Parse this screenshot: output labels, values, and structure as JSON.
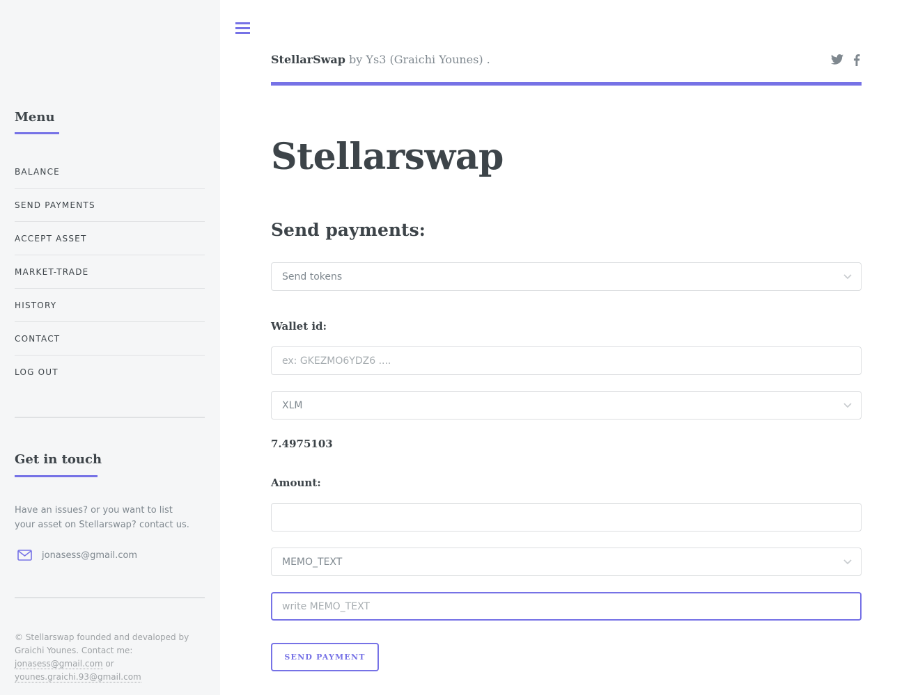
{
  "sidebar": {
    "menu_heading": "Menu",
    "items": [
      {
        "label": "BALANCE"
      },
      {
        "label": "SEND PAYMENTS"
      },
      {
        "label": "ACCEPT ASSET"
      },
      {
        "label": "MARKET-TRADE"
      },
      {
        "label": "HISTORY"
      },
      {
        "label": "CONTACT"
      },
      {
        "label": "LOG OUT"
      }
    ],
    "touch_heading": "Get in touch",
    "touch_text": "Have an issues? or you want to list your asset on Stellarswap? contact us.",
    "email": "jonasess@gmail.com",
    "footer": {
      "prefix": "© Stellarswap founded and devaloped by Graichi Younes. Contact me: ",
      "email1": "jonasess@gmail.com",
      "mid": " or ",
      "email2": "younes.graichi.93@gmail.com"
    }
  },
  "header": {
    "brand_name": "StellarSwap",
    "brand_suffix": " by Ys3 (Graichi Younes) .",
    "icons": [
      "twitter-icon",
      "facebook-icon"
    ]
  },
  "main": {
    "title": "Stellarswap",
    "section_title": "Send payments:",
    "payment_type_select": "Send tokens",
    "wallet_label": "Wallet id:",
    "wallet_placeholder": "ex: GKEZMO6YDZ6 ....",
    "asset_select": "XLM",
    "balance": "7.4975103",
    "amount_label": "Amount:",
    "amount_value": "",
    "memo_type_select": "MEMO_TEXT",
    "memo_placeholder": "write MEMO_TEXT",
    "send_button": "SEND PAYMENT"
  },
  "colors": {
    "accent": "#7672e6",
    "text": "#3d4449",
    "muted": "#7f888f",
    "sidebar_bg": "#f5f6f7"
  }
}
